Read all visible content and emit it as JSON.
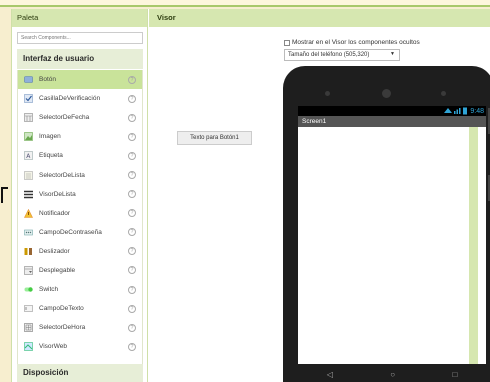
{
  "palette": {
    "title": "Paleta",
    "search_placeholder": "Search Components...",
    "category_ui": "Interfaz de usuario",
    "category_layout": "Disposición",
    "help_glyph": "?",
    "items": [
      {
        "label": "Botón",
        "icon": "button-icon",
        "color": "#8fb0d9"
      },
      {
        "label": "CasillaDeVerificación",
        "icon": "checkbox-icon",
        "color": "#7c9bc4"
      },
      {
        "label": "SelectorDeFecha",
        "icon": "date-picker-icon",
        "color": "#888"
      },
      {
        "label": "Imagen",
        "icon": "image-icon",
        "color": "#6aa84f"
      },
      {
        "label": "Etiqueta",
        "icon": "label-icon",
        "color": "#9aa"
      },
      {
        "label": "SelectorDeLista",
        "icon": "list-picker-icon",
        "color": "#aaa"
      },
      {
        "label": "VisorDeLista",
        "icon": "list-view-icon",
        "color": "#333"
      },
      {
        "label": "Notificador",
        "icon": "notifier-icon",
        "color": "#e69138"
      },
      {
        "label": "CampoDeContraseña",
        "icon": "password-icon",
        "color": "#7aa"
      },
      {
        "label": "Deslizador",
        "icon": "slider-icon",
        "color": "#c90"
      },
      {
        "label": "Desplegable",
        "icon": "spinner-icon",
        "color": "#888"
      },
      {
        "label": "Switch",
        "icon": "switch-icon",
        "color": "#6c6"
      },
      {
        "label": "CampoDeTexto",
        "icon": "textbox-icon",
        "color": "#999"
      },
      {
        "label": "SelectorDeHora",
        "icon": "time-picker-icon",
        "color": "#777"
      },
      {
        "label": "VisorWeb",
        "icon": "web-viewer-icon",
        "color": "#3b7"
      }
    ]
  },
  "viewer": {
    "title": "Visor",
    "show_hidden_label": "Mostrar en el Visor los componentes ocultos",
    "phone_size": "Tamaño del teléfono (505,320)",
    "component_button": "Texto para Botón1",
    "screen_title": "Screen1",
    "status_time": "9:48"
  }
}
